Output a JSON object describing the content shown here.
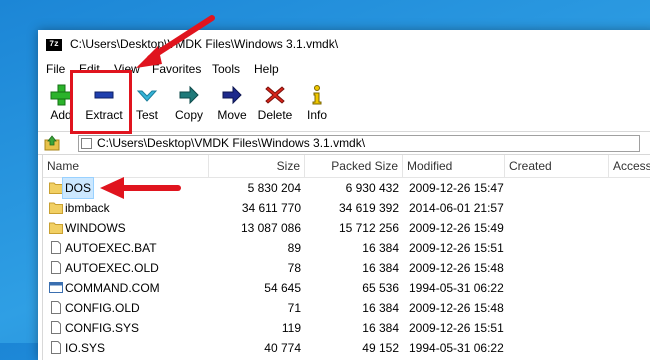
{
  "window": {
    "app_icon_text": "7z",
    "title": "C:\\Users\\Desktop\\VMDK Files\\Windows 3.1.vmdk\\"
  },
  "menu": [
    "File",
    "Edit",
    "View",
    "Favorites",
    "Tools",
    "Help"
  ],
  "toolbar": [
    {
      "label": "Add",
      "icon": "plus-icon",
      "color": "#2bb32b"
    },
    {
      "label": "Extract",
      "icon": "minus-icon",
      "color": "#1f3fae"
    },
    {
      "label": "Test",
      "icon": "check-icon",
      "color": "#35b4d8"
    },
    {
      "label": "Copy",
      "icon": "copy-arrow-icon",
      "color": "#1f7a7a"
    },
    {
      "label": "Move",
      "icon": "move-arrow-icon",
      "color": "#1e2a8c"
    },
    {
      "label": "Delete",
      "icon": "delete-x-icon",
      "color": "#d9261c"
    },
    {
      "label": "Info",
      "icon": "info-icon",
      "color": "#f0c800"
    }
  ],
  "address": {
    "path": "C:\\Users\\Desktop\\VMDK Files\\Windows 3.1.vmdk\\"
  },
  "columns": [
    "Name",
    "Size",
    "Packed Size",
    "Modified",
    "Created",
    "Accesse"
  ],
  "files": [
    {
      "name": "DOS",
      "type": "folder",
      "size": "5 830 204",
      "packed": "6 930 432",
      "modified": "2009-12-26 15:47",
      "selected": true
    },
    {
      "name": "ibmback",
      "type": "folder",
      "size": "34 611 770",
      "packed": "34 619 392",
      "modified": "2014-06-01 21:57"
    },
    {
      "name": "WINDOWS",
      "type": "folder",
      "size": "13 087 086",
      "packed": "15 712 256",
      "modified": "2009-12-26 15:49"
    },
    {
      "name": "AUTOEXEC.BAT",
      "type": "file",
      "size": "89",
      "packed": "16 384",
      "modified": "2009-12-26 15:51"
    },
    {
      "name": "AUTOEXEC.OLD",
      "type": "file",
      "size": "78",
      "packed": "16 384",
      "modified": "2009-12-26 15:48"
    },
    {
      "name": "COMMAND.COM",
      "type": "exe",
      "size": "54 645",
      "packed": "65 536",
      "modified": "1994-05-31 06:22"
    },
    {
      "name": "CONFIG.OLD",
      "type": "file",
      "size": "71",
      "packed": "16 384",
      "modified": "2009-12-26 15:48"
    },
    {
      "name": "CONFIG.SYS",
      "type": "file",
      "size": "119",
      "packed": "16 384",
      "modified": "2009-12-26 15:51"
    },
    {
      "name": "IO.SYS",
      "type": "file",
      "size": "40 774",
      "packed": "49 152",
      "modified": "1994-05-31 06:22"
    }
  ],
  "annotation": {
    "color": "#e0141e"
  }
}
